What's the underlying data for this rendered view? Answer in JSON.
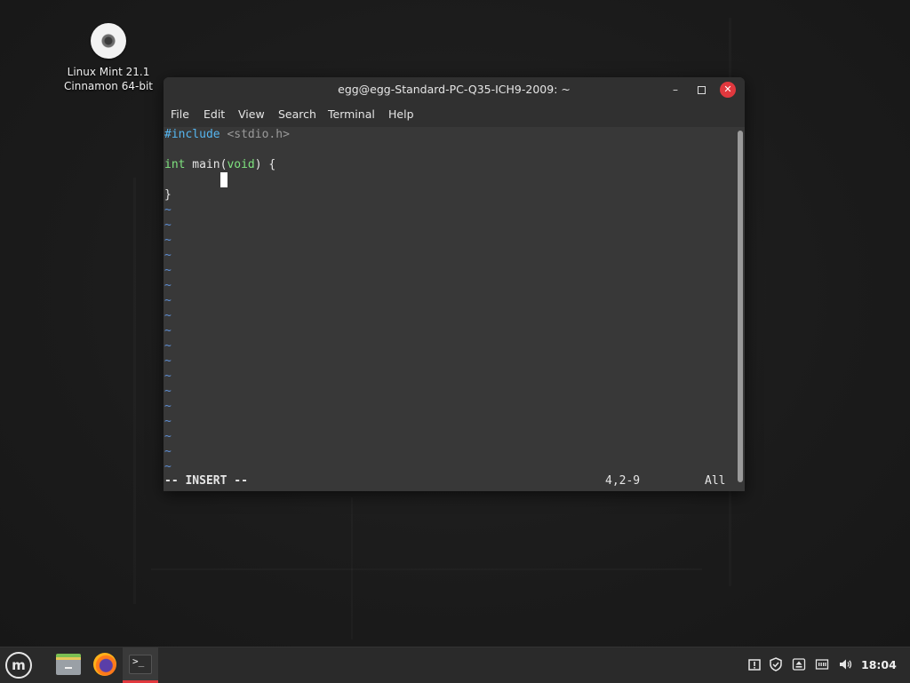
{
  "desktop": {
    "icon_label_line1": "Linux Mint 21.1",
    "icon_label_line2": "Cinnamon 64-bit",
    "icon_name": "disc-icon"
  },
  "window": {
    "title": "egg@egg-Standard-PC-Q35-ICH9-2009: ~",
    "minimize": "–",
    "close": "✕",
    "menu": [
      "File",
      "Edit",
      "View",
      "Search",
      "Terminal",
      "Help"
    ]
  },
  "editor": {
    "line1_directive": "#include",
    "line1_header": " <stdio.h>",
    "line2_type": "int",
    "line2_mid": " main(",
    "line2_kw": "void",
    "line2_end": ") {",
    "line4": "}",
    "tilde": "~",
    "tilde_count": 18,
    "mode": "-- INSERT --",
    "position": "4,2-9",
    "scroll": "All"
  },
  "taskbar": {
    "menu_glyph": "m",
    "launchers": [
      "files-icon",
      "firefox-icon",
      "terminal-icon"
    ],
    "terminal_glyph": ">_",
    "clock": "18:04",
    "tray_icons": [
      "update-manager-icon",
      "shield-icon",
      "eject-icon",
      "network-icon",
      "volume-icon"
    ]
  },
  "colors": {
    "accent_red": "#e0383e",
    "preprocessor": "#56b6f0",
    "keyword": "#7fe37f",
    "tilde": "#5e8fd6"
  }
}
